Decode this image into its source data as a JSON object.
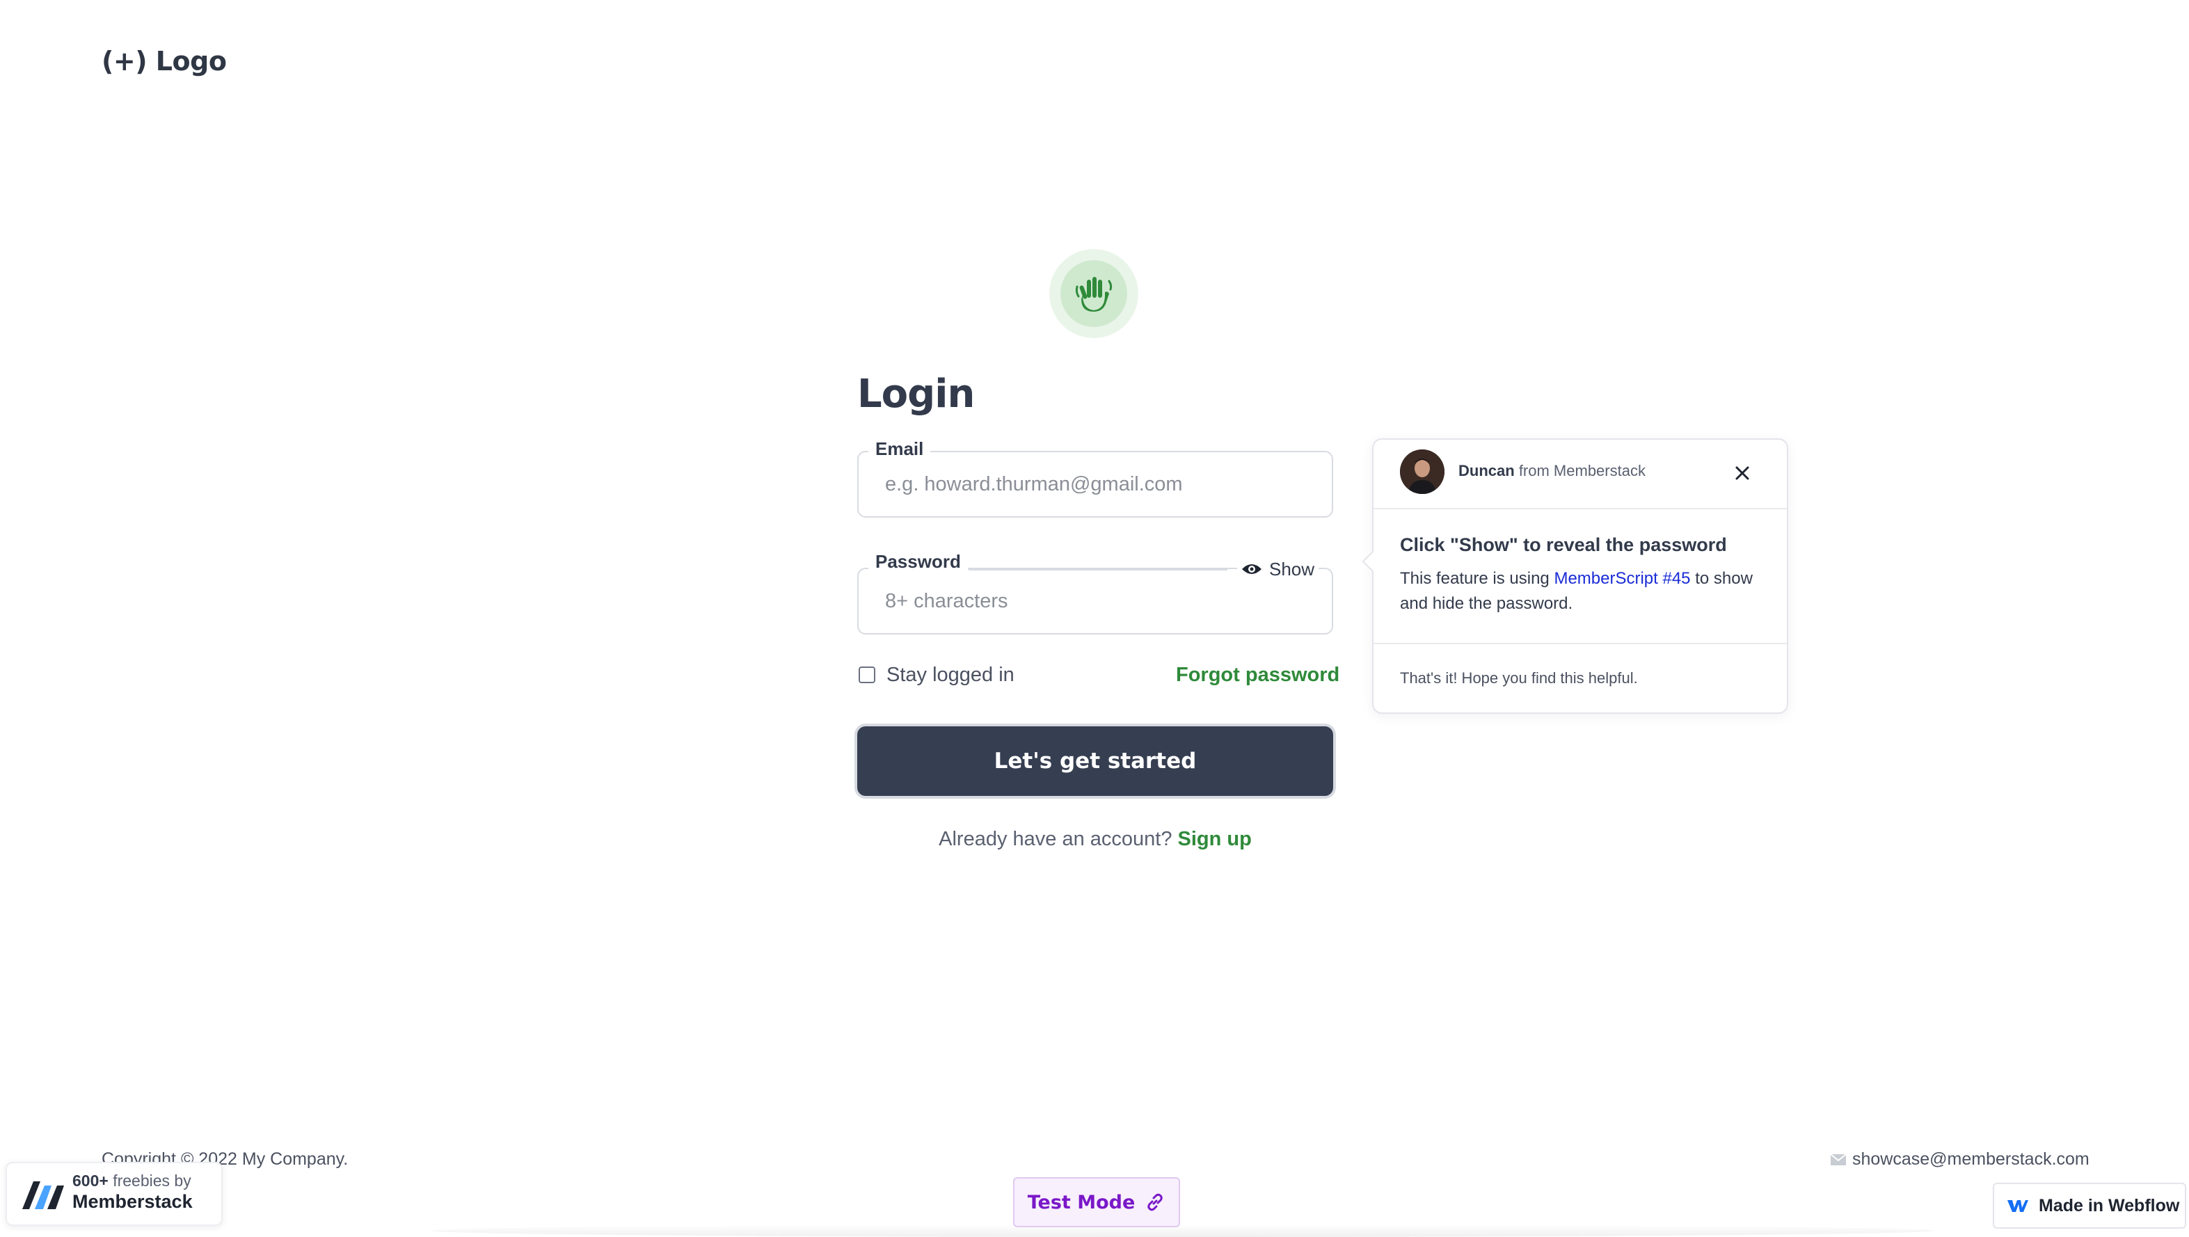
{
  "header": {
    "logo_text": "(+) Logo"
  },
  "icons": {
    "hero": "waving-hand-icon",
    "show": "eye-icon",
    "close": "close-icon",
    "link": "link-icon",
    "mail": "mail-icon",
    "webflow": "webflow-icon",
    "memberstack": "memberstack-icon"
  },
  "colors": {
    "accent": "#2f8a3a",
    "button": "#363e51",
    "link": "#1a2cd6",
    "test_mode": "#7a18c8"
  },
  "login": {
    "title": "Login",
    "email_label": "Email",
    "email_value": "",
    "email_placeholder": "e.g. howard.thurman@gmail.com",
    "password_label": "Password",
    "password_value": "",
    "password_placeholder": "8+ characters",
    "show_label": "Show",
    "stay_logged_in_label": "Stay logged in",
    "stay_logged_in_checked": false,
    "forgot_password_label": "Forgot password",
    "submit_label": "Let's get started",
    "already_text": "Already have an account?",
    "signup_label": "Sign up"
  },
  "tooltip": {
    "author_name": "Duncan",
    "author_suffix": "from Memberstack",
    "title": "Click \"Show\" to reveal the password",
    "body_prefix": "This feature is using",
    "body_link": "MemberScript #45",
    "body_suffix": "to show and hide the password.",
    "footer": "That's it! Hope you find this helpful."
  },
  "footer": {
    "copyright": "Copyright © 2022 My Company.",
    "contact_email": "showcase@memberstack.com"
  },
  "badges": {
    "memberstack_prefix": "600+",
    "memberstack_small": "freebies by",
    "memberstack_name": "Memberstack",
    "test_mode": "Test Mode",
    "webflow": "Made in Webflow"
  }
}
